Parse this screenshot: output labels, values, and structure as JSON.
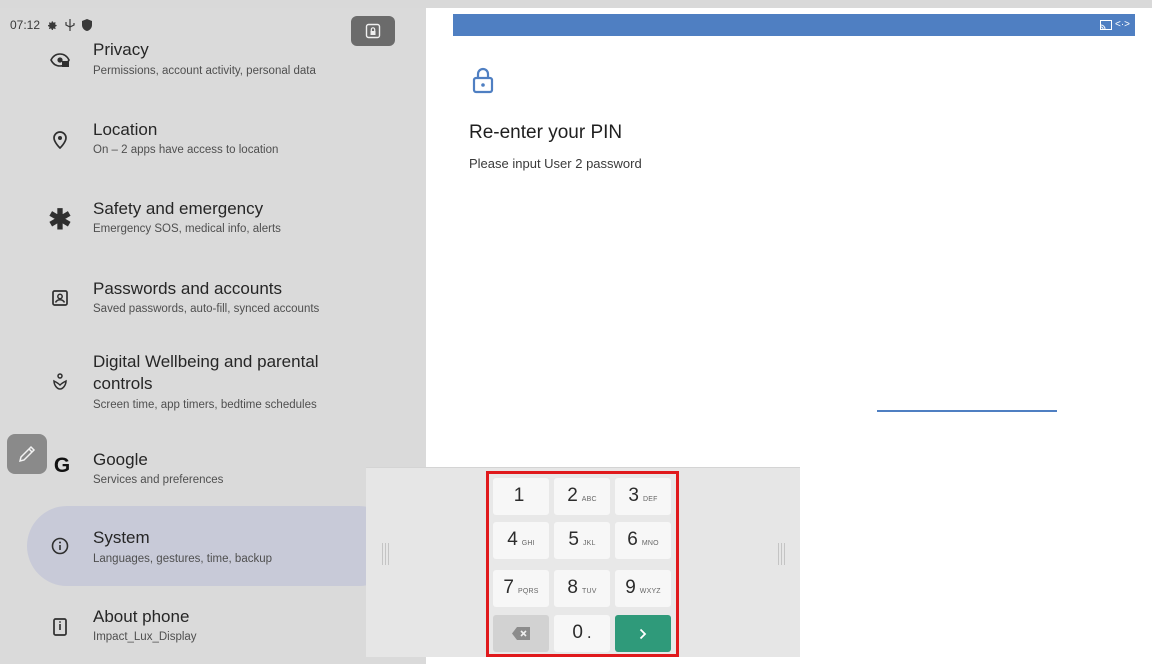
{
  "status_bar": {
    "time": "07:12",
    "icons": [
      "gear-icon",
      "usb-icon",
      "shield-icon"
    ]
  },
  "settings_list": [
    {
      "key": "privacy",
      "title": "Privacy",
      "subtitle": "Permissions, account activity, personal data",
      "icon": "eye-lock-icon"
    },
    {
      "key": "location",
      "title": "Location",
      "subtitle": "On – 2 apps have access to location",
      "icon": "location-pin-icon"
    },
    {
      "key": "safety",
      "title": "Safety and emergency",
      "subtitle": "Emergency SOS, medical info, alerts",
      "icon": "asterisk-icon"
    },
    {
      "key": "passwords",
      "title": "Passwords and accounts",
      "subtitle": "Saved passwords, auto-fill, synced accounts",
      "icon": "account-box-icon"
    },
    {
      "key": "wellbeing",
      "title_line1": "Digital Wellbeing and parental",
      "title_line2": "controls",
      "subtitle": "Screen time, app timers, bedtime schedules",
      "icon": "wellbeing-icon"
    },
    {
      "key": "google",
      "title": "Google",
      "subtitle": "Services and preferences",
      "icon": "google-g-icon"
    },
    {
      "key": "system",
      "title": "System",
      "subtitle": "Languages, gestures, time, backup",
      "icon": "info-icon",
      "selected": true
    },
    {
      "key": "about",
      "title": "About phone",
      "subtitle": "Impact_Lux_Display",
      "icon": "phone-icon"
    }
  ],
  "pin_screen": {
    "title": "Re-enter your PIN",
    "subtitle": "Please input User 2 password",
    "accent_color": "#4f7fc2"
  },
  "keypad": {
    "keys": [
      {
        "num": "1",
        "letters": ""
      },
      {
        "num": "2",
        "letters": "ABC"
      },
      {
        "num": "3",
        "letters": "DEF"
      },
      {
        "num": "4",
        "letters": "GHI"
      },
      {
        "num": "5",
        "letters": "JKL"
      },
      {
        "num": "6",
        "letters": "MNO"
      },
      {
        "num": "7",
        "letters": "PQRS"
      },
      {
        "num": "8",
        "letters": "TUV"
      },
      {
        "num": "9",
        "letters": "WXYZ"
      },
      {
        "num": "0",
        "letters": "."
      }
    ],
    "go_color": "#2f9a7a",
    "highlight_color": "#e0191c"
  }
}
